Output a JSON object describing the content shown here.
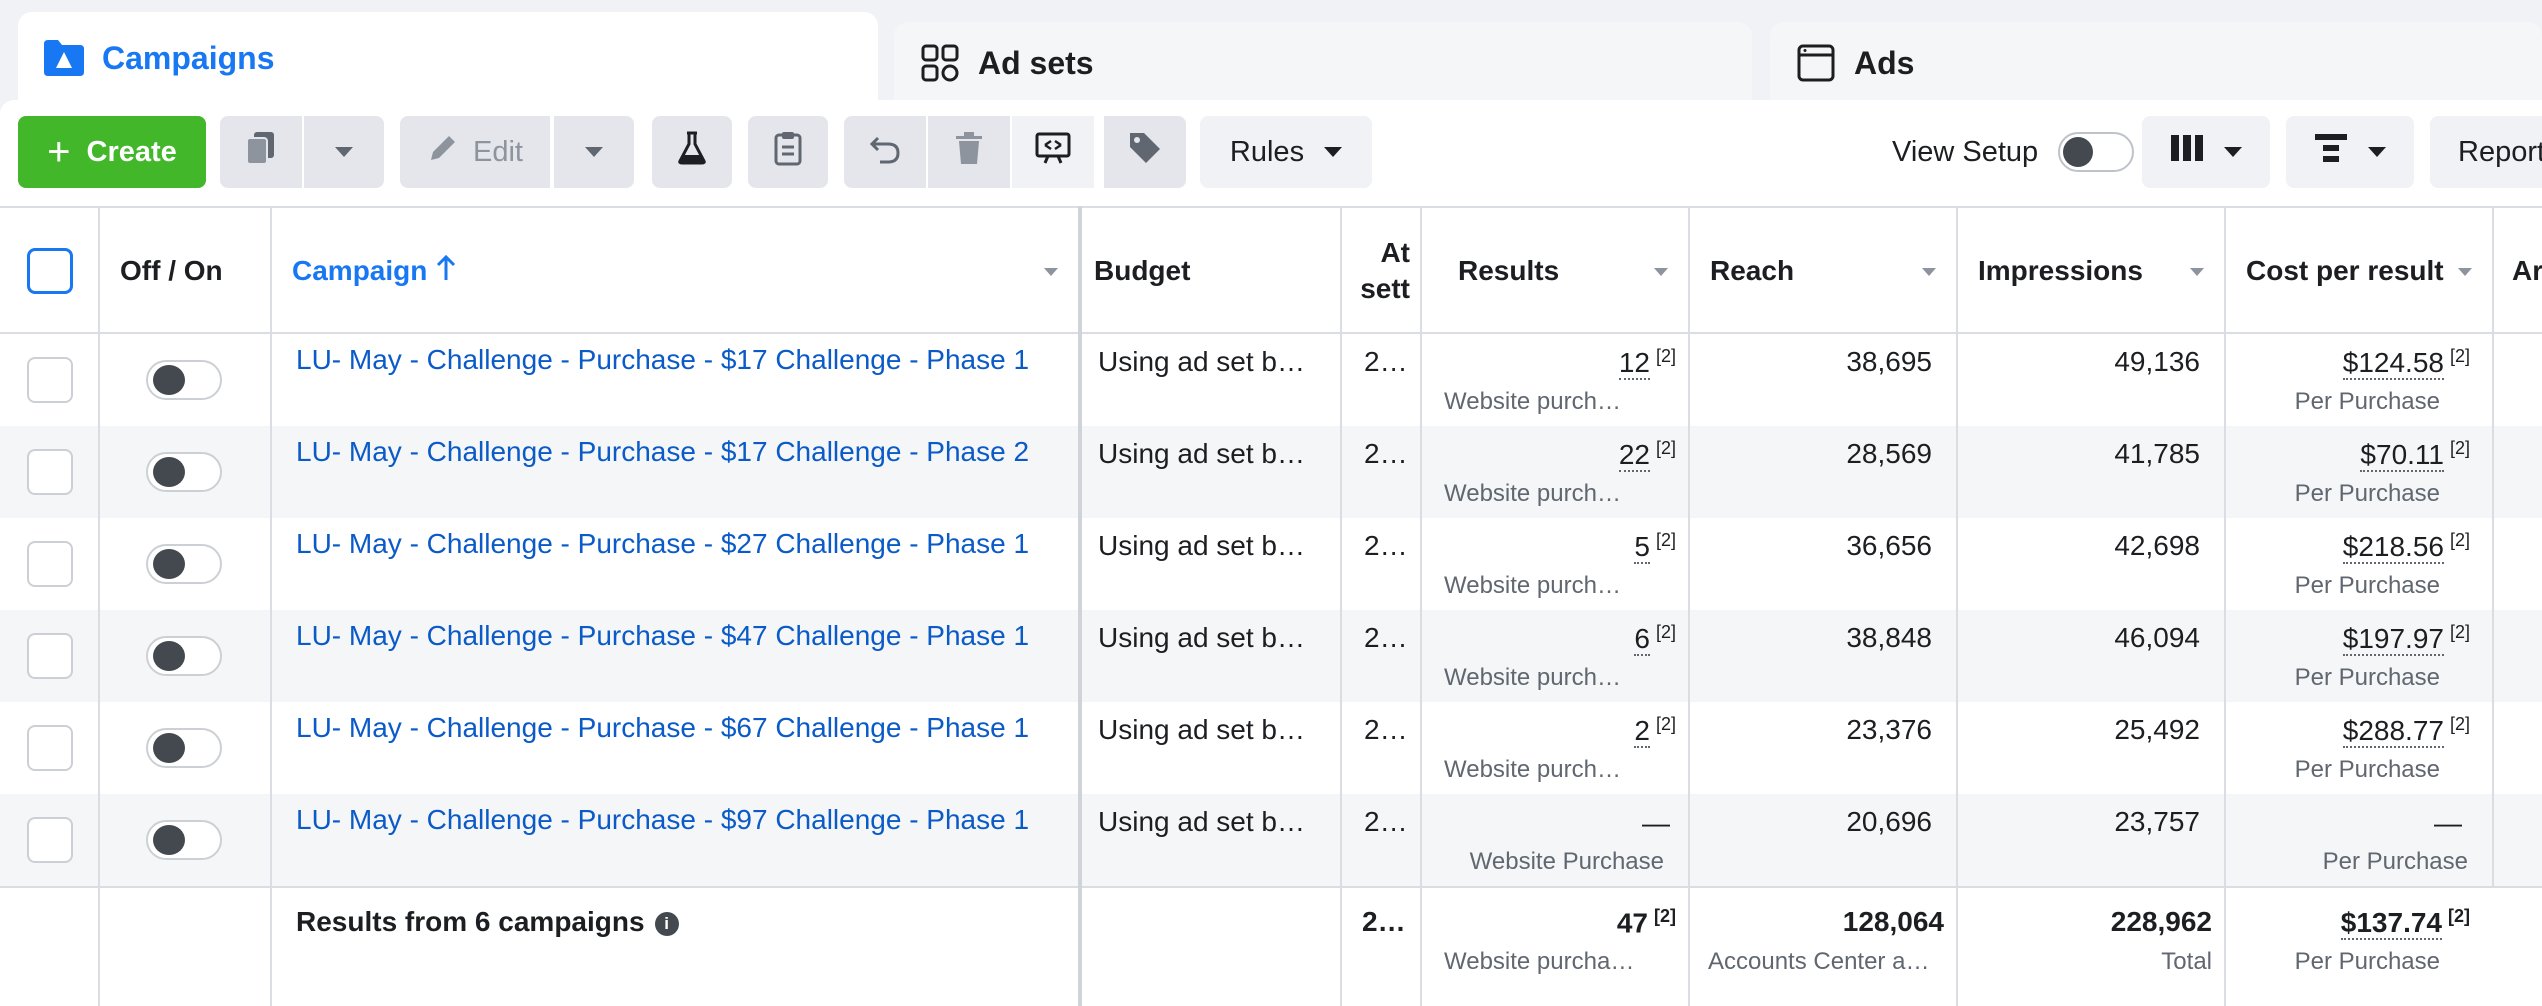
{
  "tabs": [
    {
      "label": "Campaigns",
      "icon": "folder-icon",
      "active": true
    },
    {
      "label": "Ad sets",
      "icon": "grid-icon",
      "active": false
    },
    {
      "label": "Ads",
      "icon": "ad-window-icon",
      "active": false
    }
  ],
  "toolbar": {
    "create_label": "Create",
    "edit_label": "Edit",
    "rules_label": "Rules",
    "view_setup_label": "View Setup",
    "reports_label": "Report"
  },
  "columns": {
    "off_on": "Off / On",
    "campaign": "Campaign",
    "budget": "Budget",
    "attribution": "At sett",
    "results": "Results",
    "reach": "Reach",
    "impressions": "Impressions",
    "cost_per_result": "Cost per result",
    "amount": "Ar"
  },
  "rows": [
    {
      "campaign": "LU- May - Challenge - Purchase - $17 Challenge - Phase 1",
      "budget": "Using ad set bu…",
      "attribution": "2…",
      "results": "12",
      "results_sup": "[2]",
      "results_sub": "Website purcha…",
      "reach": "38,695",
      "impressions": "49,136",
      "cost": "$124.58",
      "cost_sup": "[2]",
      "cost_sub": "Per Purchase"
    },
    {
      "campaign": "LU- May - Challenge - Purchase - $17 Challenge - Phase 2",
      "budget": "Using ad set bu…",
      "attribution": "2…",
      "results": "22",
      "results_sup": "[2]",
      "results_sub": "Website purcha…",
      "reach": "28,569",
      "impressions": "41,785",
      "cost": "$70.11",
      "cost_sup": "[2]",
      "cost_sub": "Per Purchase"
    },
    {
      "campaign": "LU- May - Challenge - Purchase - $27 Challenge - Phase 1",
      "budget": "Using ad set bu…",
      "attribution": "2…",
      "results": "5",
      "results_sup": "[2]",
      "results_sub": "Website purcha…",
      "reach": "36,656",
      "impressions": "42,698",
      "cost": "$218.56",
      "cost_sup": "[2]",
      "cost_sub": "Per Purchase"
    },
    {
      "campaign": "LU- May - Challenge - Purchase - $47 Challenge - Phase 1",
      "budget": "Using ad set bu…",
      "attribution": "2…",
      "results": "6",
      "results_sup": "[2]",
      "results_sub": "Website purcha…",
      "reach": "38,848",
      "impressions": "46,094",
      "cost": "$197.97",
      "cost_sup": "[2]",
      "cost_sub": "Per Purchase"
    },
    {
      "campaign": "LU- May - Challenge - Purchase - $67 Challenge - Phase 1",
      "budget": "Using ad set bu…",
      "attribution": "2…",
      "results": "2",
      "results_sup": "[2]",
      "results_sub": "Website purcha…",
      "reach": "23,376",
      "impressions": "25,492",
      "cost": "$288.77",
      "cost_sup": "[2]",
      "cost_sub": "Per Purchase"
    },
    {
      "campaign": "LU- May - Challenge - Purchase - $97 Challenge - Phase 1",
      "budget": "Using ad set bu…",
      "attribution": "2…",
      "results": "—",
      "results_sup": "",
      "results_sub": "Website Purchase",
      "reach": "20,696",
      "impressions": "23,757",
      "cost": "—",
      "cost_sup": "",
      "cost_sub": "Per Purchase"
    }
  ],
  "footer": {
    "label": "Results from 6 campaigns",
    "info_icon": "i",
    "attribution": "2…",
    "results": "47",
    "results_sup": "[2]",
    "results_sub": "Website purchases",
    "reach": "128,064",
    "reach_sub": "Accounts Center ac…",
    "impressions": "228,962",
    "impressions_sub": "Total",
    "cost": "$137.74",
    "cost_sup": "[2]",
    "cost_sub": "Per Purchase"
  },
  "colors": {
    "accent": "#1877f2",
    "create": "#42b72a",
    "link": "#0a5ac8"
  }
}
